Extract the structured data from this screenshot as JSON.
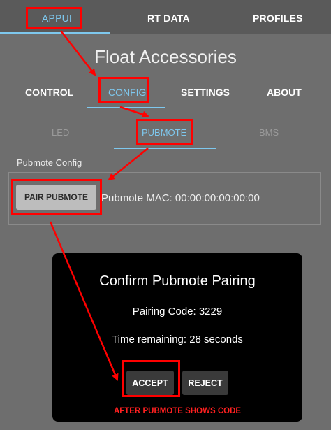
{
  "top_tabs": [
    {
      "label": "APPUI"
    },
    {
      "label": "RT DATA"
    },
    {
      "label": "PROFILES"
    }
  ],
  "page_title": "Float Accessories",
  "sub_tabs": [
    {
      "label": "CONTROL"
    },
    {
      "label": "CONFIG"
    },
    {
      "label": "SETTINGS"
    },
    {
      "label": "ABOUT"
    }
  ],
  "config_tabs": [
    {
      "label": "LED"
    },
    {
      "label": "PUBMOTE"
    },
    {
      "label": "BMS"
    }
  ],
  "pubmote_config": {
    "section_label": "Pubmote Config",
    "pair_button_label": "PAIR PUBMOTE",
    "mac_text": "Pubmote MAC: 00:00:00:00:00:00"
  },
  "dialog": {
    "title": "Confirm Pubmote Pairing",
    "pairing_code_text": "Pairing Code: 3229",
    "time_remaining_text": "Time remaining: 28 seconds",
    "accept_label": "ACCEPT",
    "reject_label": "REJECT"
  },
  "annotation": {
    "caption": "AFTER PUBMOTE SHOWS CODE",
    "color": "#ff0000"
  },
  "colors": {
    "background": "#6e6e6e",
    "topbar": "#5a5a5a",
    "accent": "#7ec8ee",
    "dialog_bg": "#000000"
  }
}
